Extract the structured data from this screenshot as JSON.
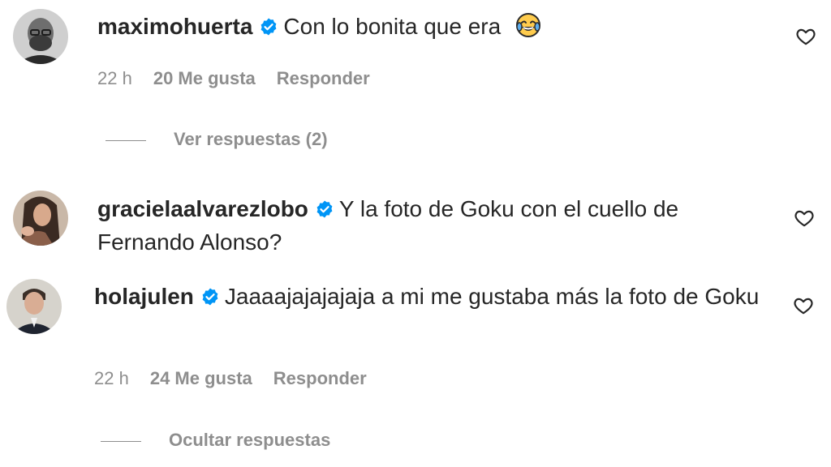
{
  "comments": [
    {
      "username": "maximohuerta",
      "text": "Con lo bonita que era",
      "time": "22 h",
      "likes": "20 Me gusta",
      "reply_label": "Responder",
      "thread_toggle": "Ver respuestas (2)"
    },
    {
      "username": "gracielaalvarezlobo",
      "text": "Y la foto de Goku con el cuello de Fernando Alonso?"
    },
    {
      "username": "holajulen",
      "text": "Jaaaajajajajaja a mi me gustaba más la foto de Goku",
      "time": "22 h",
      "likes": "24 Me gusta",
      "reply_label": "Responder",
      "thread_toggle": "Ocultar respuestas"
    }
  ],
  "colors": {
    "text": "#262626",
    "secondary": "#8e8e8e",
    "verified": "#0095f6"
  },
  "icons": {
    "verified": "verified-badge-icon",
    "like": "heart-icon",
    "emoji": "laughing-tears-emoji-icon"
  }
}
